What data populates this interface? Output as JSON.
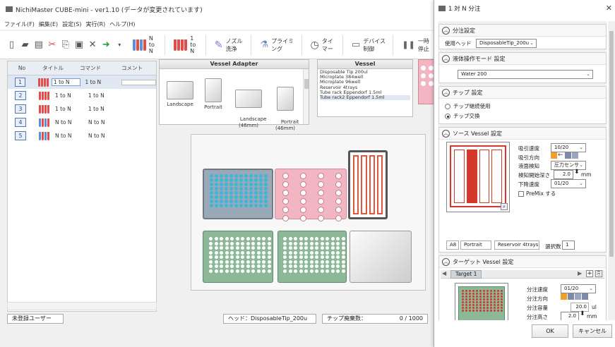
{
  "app": {
    "title": "NichiMaster CUBE-mini -  ver1.10 (データが変更されています)",
    "menu": [
      "ファイル(F)",
      "編集(E)",
      "設定(S)",
      "実行(R)",
      "ヘルプ(H)"
    ]
  },
  "toolbar": {
    "n_to_n": "N to N",
    "one_to_n": "1 to N",
    "nozzle_wash": "ノズル洗浄",
    "priming": "プライミング",
    "timer": "タイマー",
    "device_control": "デバイス制御",
    "pause": "一時停止"
  },
  "steps": {
    "headers": [
      "No",
      "タイトル",
      "コマンド",
      "コメント"
    ],
    "rows": [
      {
        "no": "1",
        "title": "1 to N",
        "command": "1 to N",
        "tube": "red"
      },
      {
        "no": "2",
        "title": "1 to N",
        "command": "1 to N",
        "tube": "red"
      },
      {
        "no": "3",
        "title": "1 to N",
        "command": "1 to N",
        "tube": "red"
      },
      {
        "no": "4",
        "title": "N to N",
        "command": "N to N",
        "tube": "blue"
      },
      {
        "no": "5",
        "title": "N to N",
        "command": "N to N",
        "tube": "blue"
      }
    ]
  },
  "vessel_adapter": {
    "title": "Vessel Adapter",
    "items": [
      {
        "label": "Landscape"
      },
      {
        "label": "Portrait"
      },
      {
        "label": "Landscape\n(46mm)"
      },
      {
        "label": "Portrait\n(46mm)"
      }
    ]
  },
  "vessel": {
    "title": "Vessel",
    "items": [
      "Disposable Tip 200ul",
      "Microplate 384well",
      "Microplate 96well",
      "Reservoir 4trays",
      "Tube rack Eppendorf 1.5ml",
      "Tube rack2 Eppendorf 1.5ml"
    ],
    "selected_index": 5
  },
  "status": {
    "user": "未登録ユーザー",
    "head": "ヘッド：DisposableTip_200u",
    "tip_waste_label": "チップ廃棄数：",
    "tip_waste_value": "0 / 1000"
  },
  "dialog": {
    "title": "1 対 N 分注",
    "dispense_settings": {
      "title": "分注設定",
      "head_label": "使用ヘッド",
      "head_value": "DisposableTip_200u"
    },
    "liquid_mode": {
      "title": "液体操作モード 設定",
      "value": "Water 200"
    },
    "tip": {
      "title": "チップ 設定",
      "opt_continue": "チップ継続使用",
      "opt_change": "チップ交換",
      "selected": "change"
    },
    "source": {
      "title": "ソース Vessel 設定",
      "aspirate_speed_label": "吸引速度",
      "aspirate_speed_value": "10/20",
      "aspirate_dir_label": "吸引方向",
      "liquid_detect_label": "液面検知",
      "liquid_detect_value": "圧力センサ",
      "detect_depth_label": "検知開始深さ",
      "detect_depth_value": "2.0",
      "detect_depth_unit": "mm",
      "descent_speed_label": "下降速度",
      "descent_speed_value": "01/20",
      "premix_label": "PreMix する",
      "position": "A8",
      "orientation": "Portrait",
      "vessel_name": "Reservoir 4trays",
      "select_count_label": "選択数",
      "select_count_value": "1",
      "selected_column": 2
    },
    "target": {
      "title": "ターゲット Vessel 設定",
      "tab": "Target 1",
      "dispense_speed_label": "分注速度",
      "dispense_speed_value": "01/20",
      "dispense_dir_label": "分注方向",
      "dispense_volume_label": "分注容量",
      "dispense_volume_value": "20.0",
      "dispense_volume_unit": "ul",
      "dispense_height_label": "分注高さ",
      "dispense_height_value": "2.0",
      "dispense_height_unit": "mm"
    },
    "ok": "OK",
    "cancel": "キャンセル"
  },
  "colors": {
    "blue_plate": "#9aa9b8",
    "blue_well": "#3ab7d8",
    "pink_rack": "#f2b6c3",
    "reservoir": "#e0563f",
    "green_plate": "#8cb898",
    "selection": "#d4382a"
  }
}
